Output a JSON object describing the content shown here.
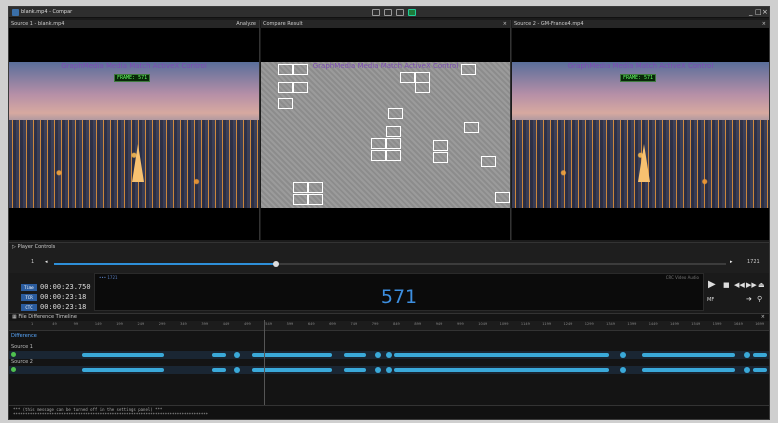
{
  "window": {
    "title": "blank.mp4 - Compar"
  },
  "panes": [
    {
      "header": "Source 1 - blank.mp4",
      "right": "Analyze"
    },
    {
      "header": "Compare Result",
      "right": "×"
    },
    {
      "header": "Source 2 - GM-France4.mp4",
      "right": "×"
    }
  ],
  "watermark": "GraphMedia Media Match ActiveX Control",
  "frame_overlay": "FRAME: 571",
  "player": {
    "header": "Player Controls",
    "start": "1",
    "end": "1721",
    "progress": 0.33
  },
  "timecodes": [
    {
      "label": "Time",
      "value": "00:00:23.750"
    },
    {
      "label": "TCR",
      "value": "00:00:23:18"
    },
    {
      "label": "CTC",
      "value": "00:00:23:18"
    }
  ],
  "frame": {
    "number": "571",
    "small": "••• 1721",
    "tabs": "CRC  Video  Audio"
  },
  "controls": {
    "mf": "MF"
  },
  "diff": {
    "header": "File Difference Timeline",
    "section": "Difference",
    "source1": "Source 1",
    "source2": "Source 2",
    "ticks": [
      "1",
      "49",
      "99",
      "149",
      "199",
      "249",
      "299",
      "349",
      "399",
      "449",
      "499",
      "549",
      "599",
      "649",
      "699",
      "749",
      "799",
      "849",
      "899",
      "949",
      "999",
      "1049",
      "1099",
      "1149",
      "1199",
      "1249",
      "1299",
      "1349",
      "1399",
      "1449",
      "1499",
      "1549",
      "1599",
      "1649",
      "1699"
    ]
  },
  "log": {
    "line1": "***          (this message can be turned off in the settings panel)          ***",
    "line2": "*********************************************************************************"
  },
  "colors": {
    "accent": "#2e8fd8",
    "segment": "#3aa9d9"
  }
}
